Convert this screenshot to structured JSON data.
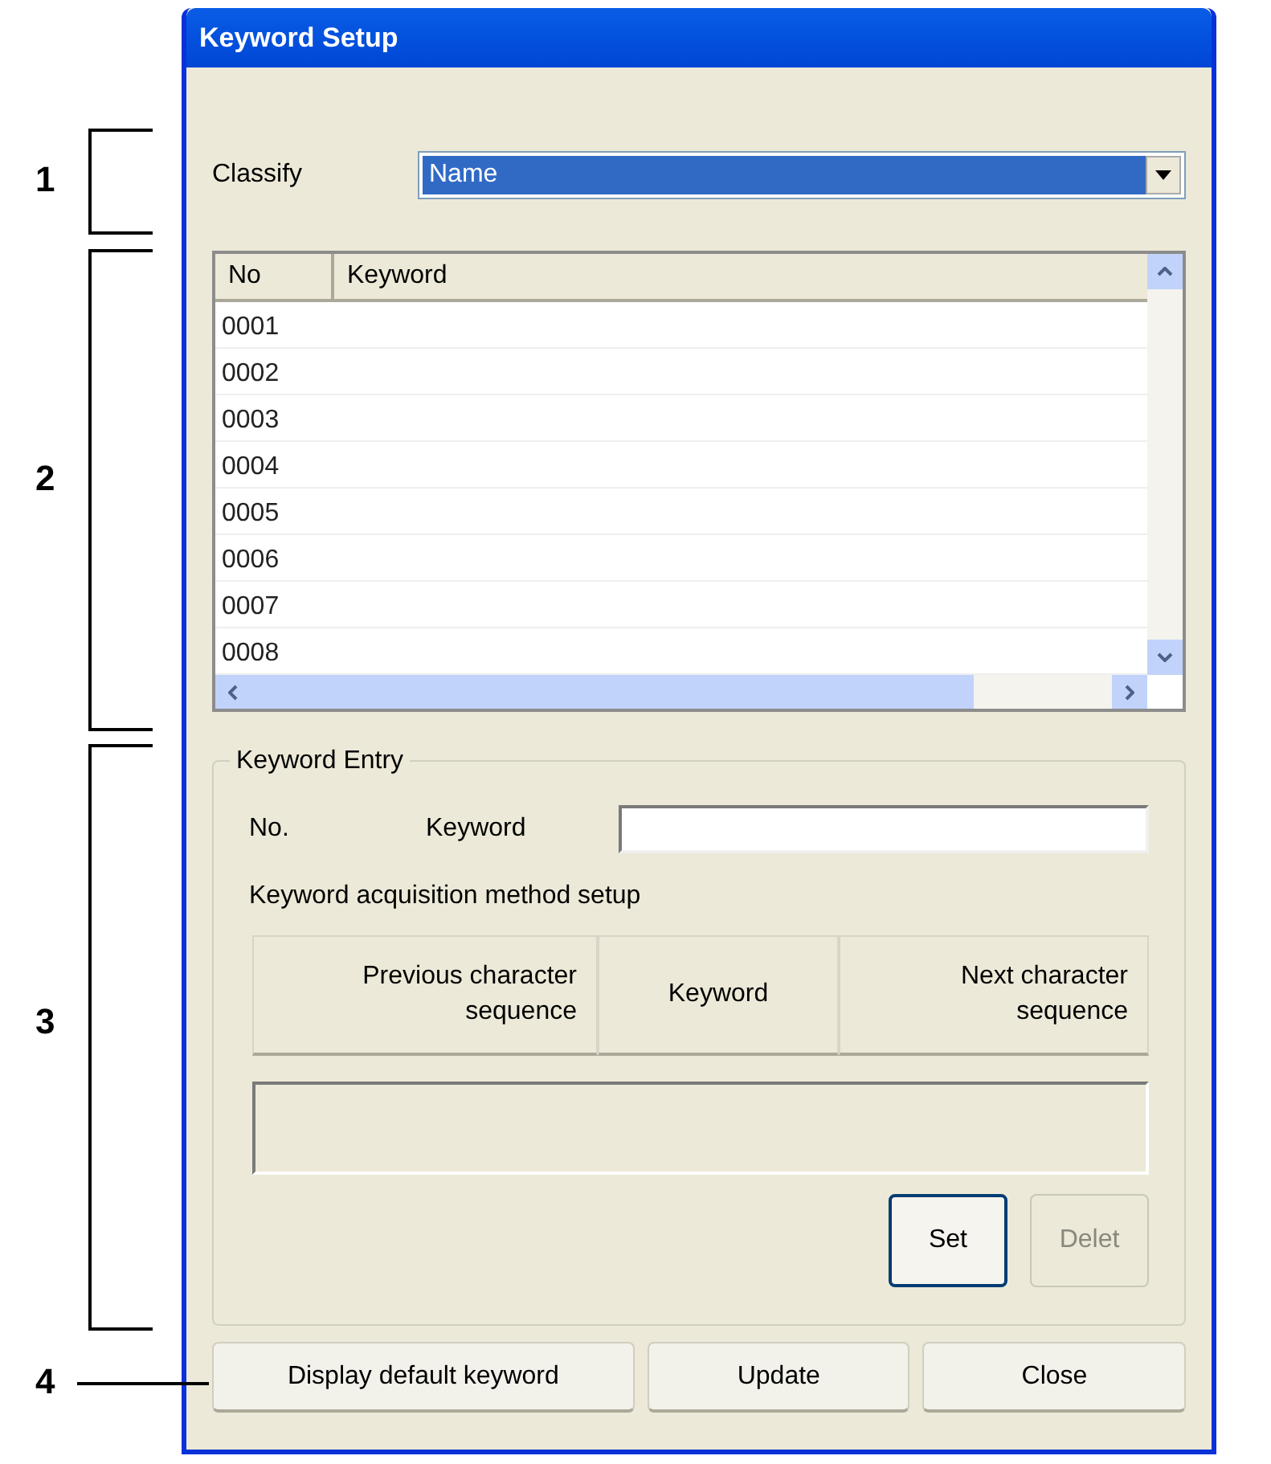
{
  "window": {
    "title": "Keyword Setup"
  },
  "classify": {
    "label": "Classify",
    "value": "Name",
    "selected": true
  },
  "keyword_list": {
    "columns": [
      "No",
      "Keyword"
    ],
    "rows": [
      "0001",
      "0002",
      "0003",
      "0004",
      "0005",
      "0006",
      "0007",
      "0008"
    ]
  },
  "keyword_entry": {
    "title": "Keyword Entry",
    "no_label": "No.",
    "keyword_label": "Keyword",
    "method_label": "Keyword acquisition method setup",
    "method_buttons": [
      "Previous character sequence",
      "Keyword",
      "Next character sequence"
    ],
    "buttons": [
      {
        "label": "Set",
        "disabled": false
      },
      {
        "label": "Delet",
        "disabled": true
      }
    ]
  },
  "buttons": [
    "Display default keyword",
    "Update",
    "Close"
  ],
  "callouts": [
    {
      "label": "1",
      "kind": "bracket"
    },
    {
      "label": "2",
      "kind": "bracket"
    },
    {
      "label": "3",
      "kind": "bracket"
    },
    {
      "label": "4",
      "kind": "line"
    }
  ]
}
